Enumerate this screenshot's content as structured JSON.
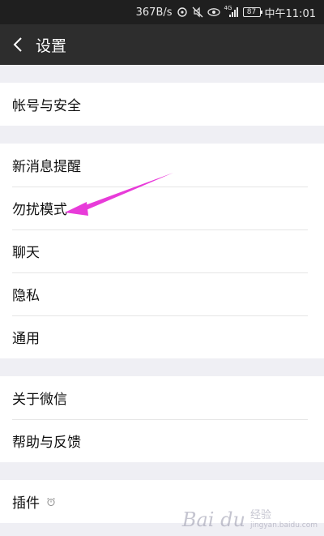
{
  "status_bar": {
    "speed": "367B/s",
    "battery": "87",
    "time": "中午11:01",
    "network": "4G"
  },
  "nav": {
    "title": "设置"
  },
  "groups": [
    {
      "items": [
        {
          "label": "帐号与安全"
        }
      ]
    },
    {
      "items": [
        {
          "label": "新消息提醒"
        },
        {
          "label": "勿扰模式"
        },
        {
          "label": "聊天"
        },
        {
          "label": "隐私"
        },
        {
          "label": "通用"
        }
      ]
    },
    {
      "items": [
        {
          "label": "关于微信"
        },
        {
          "label": "帮助与反馈"
        }
      ]
    },
    {
      "items": [
        {
          "label": "插件"
        }
      ]
    }
  ],
  "annotation": {
    "color": "#e83bd9"
  },
  "watermark": {
    "brand": "Bai du",
    "sub1": "经验",
    "sub2": "jingyan.baidu.com"
  },
  "colors": {
    "status_bg": "#1f1f1f",
    "nav_bg": "#2d2d2d",
    "page_bg": "#efeff4",
    "row_bg": "#ffffff"
  }
}
